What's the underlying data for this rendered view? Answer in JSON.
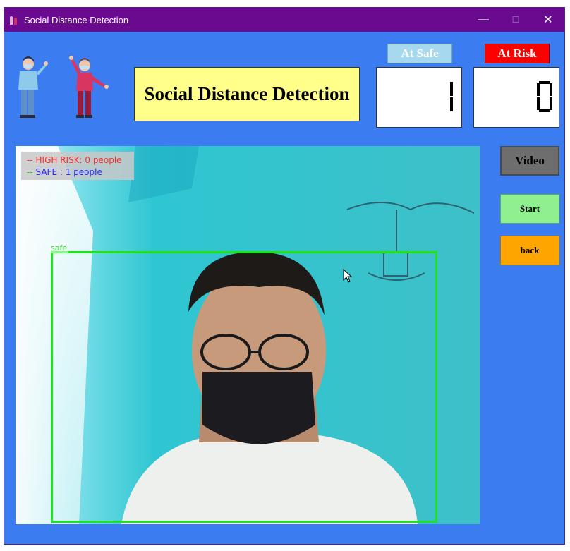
{
  "window": {
    "title": "Social Distance Detection",
    "controls": {
      "minimize": "—",
      "maximize": "☐",
      "close": "✕"
    }
  },
  "header": {
    "title": "Social Distance Detection",
    "safe_label": "At Safe",
    "risk_label": "At Risk",
    "safe_count": "1",
    "risk_count": "0"
  },
  "video": {
    "legend_high_risk": "HIGH RISK: 0 people",
    "legend_safe": "SAFE : 1 people",
    "legend_dash": "--",
    "detection_label": "safe"
  },
  "buttons": {
    "video": "Video",
    "start": "Start",
    "back": "back"
  },
  "colors": {
    "background": "#3b7cf0",
    "titlebar": "#6a0a8e",
    "title_box": "#ffff8a",
    "safe_label": "#a6d8f0",
    "risk_label": "#ff0000",
    "video_button": "#6e6e6e",
    "start_button": "#8ef08e",
    "back_button": "#ffa500",
    "detection_box": "#22e022"
  }
}
